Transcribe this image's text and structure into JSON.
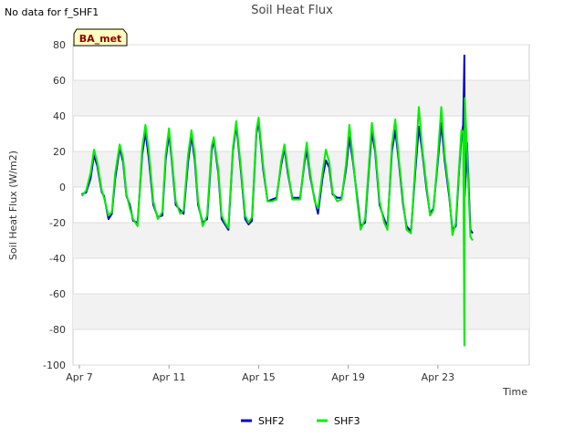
{
  "notice": "No data for f_SHF1",
  "chart_data": {
    "type": "line",
    "title": "Soil Heat Flux",
    "xlabel": "Time",
    "ylabel": "Soil Heat Flux (W/m2)",
    "badge": "BA_met",
    "ylim": [
      -100,
      80
    ],
    "yticks": [
      -100,
      -80,
      -60,
      -40,
      -20,
      0,
      20,
      40,
      60,
      80
    ],
    "xlim": [
      0,
      18
    ],
    "xticks": [
      {
        "x": 0,
        "label": "Apr 7"
      },
      {
        "x": 4,
        "label": "Apr 11"
      },
      {
        "x": 8,
        "label": "Apr 15"
      },
      {
        "x": 12,
        "label": "Apr 19"
      },
      {
        "x": 16,
        "label": "Apr 23"
      }
    ],
    "grid": "horizontal alternating bands",
    "legend": "bottom-center",
    "series": [
      {
        "name": "SHF2",
        "color": "#0000cc",
        "points": [
          [
            0.1,
            -4
          ],
          [
            0.3,
            -3
          ],
          [
            0.5,
            5
          ],
          [
            0.65,
            18
          ],
          [
            0.8,
            12
          ],
          [
            1.0,
            -3
          ],
          [
            1.1,
            -5
          ],
          [
            1.3,
            -18
          ],
          [
            1.45,
            -15
          ],
          [
            1.6,
            5
          ],
          [
            1.8,
            22
          ],
          [
            1.95,
            14
          ],
          [
            2.1,
            -5
          ],
          [
            2.25,
            -10
          ],
          [
            2.4,
            -19
          ],
          [
            2.6,
            -20
          ],
          [
            2.8,
            18
          ],
          [
            2.95,
            31
          ],
          [
            3.1,
            16
          ],
          [
            3.3,
            -10
          ],
          [
            3.5,
            -17
          ],
          [
            3.7,
            -16
          ],
          [
            3.85,
            15
          ],
          [
            4.0,
            30
          ],
          [
            4.1,
            18
          ],
          [
            4.3,
            -10
          ],
          [
            4.5,
            -13
          ],
          [
            4.65,
            -15
          ],
          [
            4.85,
            14
          ],
          [
            5.0,
            29
          ],
          [
            5.15,
            15
          ],
          [
            5.3,
            -10
          ],
          [
            5.5,
            -20
          ],
          [
            5.7,
            -18
          ],
          [
            5.9,
            20
          ],
          [
            6.0,
            27
          ],
          [
            6.2,
            8
          ],
          [
            6.35,
            -18
          ],
          [
            6.5,
            -21
          ],
          [
            6.65,
            -24
          ],
          [
            6.85,
            20
          ],
          [
            7.0,
            35
          ],
          [
            7.2,
            10
          ],
          [
            7.4,
            -18
          ],
          [
            7.55,
            -21
          ],
          [
            7.7,
            -19
          ],
          [
            7.9,
            30
          ],
          [
            8.0,
            37
          ],
          [
            8.2,
            10
          ],
          [
            8.4,
            -8
          ],
          [
            8.6,
            -7
          ],
          [
            8.8,
            -6
          ],
          [
            9.0,
            12
          ],
          [
            9.15,
            22
          ],
          [
            9.3,
            8
          ],
          [
            9.5,
            -6
          ],
          [
            9.7,
            -6
          ],
          [
            9.85,
            -6
          ],
          [
            10.05,
            14
          ],
          [
            10.15,
            21
          ],
          [
            10.3,
            6
          ],
          [
            10.5,
            -7
          ],
          [
            10.65,
            -15
          ],
          [
            10.85,
            5
          ],
          [
            11.0,
            15
          ],
          [
            11.15,
            11
          ],
          [
            11.3,
            -4
          ],
          [
            11.5,
            -6
          ],
          [
            11.7,
            -6
          ],
          [
            11.9,
            10
          ],
          [
            12.05,
            28
          ],
          [
            12.2,
            15
          ],
          [
            12.4,
            -6
          ],
          [
            12.55,
            -22
          ],
          [
            12.75,
            -20
          ],
          [
            12.95,
            15
          ],
          [
            13.05,
            31
          ],
          [
            13.2,
            20
          ],
          [
            13.4,
            -10
          ],
          [
            13.6,
            -18
          ],
          [
            13.75,
            -22
          ],
          [
            13.95,
            20
          ],
          [
            14.1,
            32
          ],
          [
            14.25,
            15
          ],
          [
            14.45,
            -10
          ],
          [
            14.6,
            -22
          ],
          [
            14.8,
            -25
          ],
          [
            15.0,
            10
          ],
          [
            15.15,
            34
          ],
          [
            15.3,
            20
          ],
          [
            15.5,
            -2
          ],
          [
            15.65,
            -15
          ],
          [
            15.8,
            -12
          ],
          [
            16.0,
            15
          ],
          [
            16.15,
            36
          ],
          [
            16.3,
            15
          ],
          [
            16.5,
            -5
          ],
          [
            16.65,
            -24
          ],
          [
            16.8,
            -22
          ],
          [
            16.95,
            10
          ],
          [
            17.05,
            28
          ],
          [
            17.13,
            35
          ],
          [
            17.18,
            74
          ],
          [
            17.2,
            -5
          ],
          [
            17.3,
            25
          ],
          [
            17.45,
            -24
          ],
          [
            17.55,
            -26
          ]
        ]
      },
      {
        "name": "SHF3",
        "color": "#00ee00",
        "points": [
          [
            0.1,
            -5
          ],
          [
            0.3,
            -2
          ],
          [
            0.5,
            8
          ],
          [
            0.65,
            21
          ],
          [
            0.8,
            14
          ],
          [
            1.0,
            -2
          ],
          [
            1.1,
            -6
          ],
          [
            1.3,
            -16
          ],
          [
            1.45,
            -14
          ],
          [
            1.6,
            8
          ],
          [
            1.8,
            24
          ],
          [
            1.95,
            16
          ],
          [
            2.1,
            -4
          ],
          [
            2.25,
            -12
          ],
          [
            2.4,
            -18
          ],
          [
            2.6,
            -22
          ],
          [
            2.8,
            22
          ],
          [
            2.95,
            35
          ],
          [
            3.1,
            20
          ],
          [
            3.3,
            -8
          ],
          [
            3.5,
            -18
          ],
          [
            3.7,
            -14
          ],
          [
            3.85,
            18
          ],
          [
            4.0,
            33
          ],
          [
            4.1,
            20
          ],
          [
            4.3,
            -8
          ],
          [
            4.5,
            -15
          ],
          [
            4.65,
            -13
          ],
          [
            4.85,
            18
          ],
          [
            5.0,
            32
          ],
          [
            5.15,
            18
          ],
          [
            5.3,
            -8
          ],
          [
            5.5,
            -22
          ],
          [
            5.7,
            -16
          ],
          [
            5.9,
            23
          ],
          [
            6.0,
            28
          ],
          [
            6.2,
            10
          ],
          [
            6.35,
            -16
          ],
          [
            6.5,
            -20
          ],
          [
            6.65,
            -23
          ],
          [
            6.85,
            22
          ],
          [
            7.0,
            37
          ],
          [
            7.2,
            12
          ],
          [
            7.4,
            -16
          ],
          [
            7.55,
            -20
          ],
          [
            7.7,
            -17
          ],
          [
            7.9,
            32
          ],
          [
            8.0,
            39
          ],
          [
            8.2,
            12
          ],
          [
            8.4,
            -8
          ],
          [
            8.6,
            -8
          ],
          [
            8.8,
            -7
          ],
          [
            9.0,
            14
          ],
          [
            9.15,
            24
          ],
          [
            9.3,
            10
          ],
          [
            9.5,
            -7
          ],
          [
            9.7,
            -7
          ],
          [
            9.85,
            -7
          ],
          [
            10.05,
            16
          ],
          [
            10.15,
            25
          ],
          [
            10.3,
            8
          ],
          [
            10.5,
            -8
          ],
          [
            10.65,
            -12
          ],
          [
            10.85,
            8
          ],
          [
            11.0,
            21
          ],
          [
            11.15,
            14
          ],
          [
            11.3,
            -3
          ],
          [
            11.5,
            -8
          ],
          [
            11.7,
            -7
          ],
          [
            11.9,
            13
          ],
          [
            12.05,
            35
          ],
          [
            12.2,
            17
          ],
          [
            12.4,
            -8
          ],
          [
            12.55,
            -24
          ],
          [
            12.75,
            -18
          ],
          [
            12.95,
            18
          ],
          [
            13.05,
            36
          ],
          [
            13.2,
            22
          ],
          [
            13.4,
            -8
          ],
          [
            13.6,
            -20
          ],
          [
            13.75,
            -24
          ],
          [
            13.95,
            24
          ],
          [
            14.1,
            38
          ],
          [
            14.25,
            17
          ],
          [
            14.45,
            -8
          ],
          [
            14.6,
            -24
          ],
          [
            14.8,
            -26
          ],
          [
            15.0,
            14
          ],
          [
            15.15,
            45
          ],
          [
            15.3,
            22
          ],
          [
            15.5,
            0
          ],
          [
            15.65,
            -16
          ],
          [
            15.8,
            -13
          ],
          [
            16.0,
            18
          ],
          [
            16.15,
            45
          ],
          [
            16.3,
            18
          ],
          [
            16.5,
            -3
          ],
          [
            16.65,
            -27
          ],
          [
            16.8,
            -20
          ],
          [
            16.95,
            12
          ],
          [
            17.05,
            32
          ],
          [
            17.13,
            30
          ],
          [
            17.18,
            -89
          ],
          [
            17.2,
            50
          ],
          [
            17.3,
            20
          ],
          [
            17.45,
            -28
          ],
          [
            17.55,
            -30
          ]
        ]
      }
    ]
  }
}
